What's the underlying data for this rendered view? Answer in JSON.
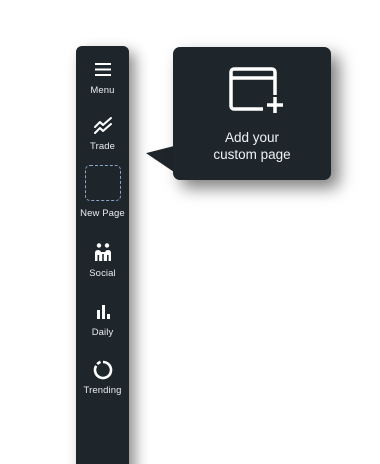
{
  "sidebar": {
    "items": [
      {
        "label": "Menu",
        "icon": "hamburger-menu-icon"
      },
      {
        "label": "Trade",
        "icon": "trade-chart-icon"
      },
      {
        "label": "New Page",
        "icon": "dashed-placeholder-icon"
      },
      {
        "label": "Social",
        "icon": "social-people-icon"
      },
      {
        "label": "Daily",
        "icon": "bar-chart-icon"
      },
      {
        "label": "Trending",
        "icon": "circular-arrow-icon"
      }
    ]
  },
  "tooltip": {
    "line1": "Add your",
    "line2": "custom page",
    "icon": "add-window-icon"
  },
  "colors": {
    "panel": "#1f262b",
    "text": "#e6ebee",
    "dashed_border": "#8aa6c9"
  }
}
